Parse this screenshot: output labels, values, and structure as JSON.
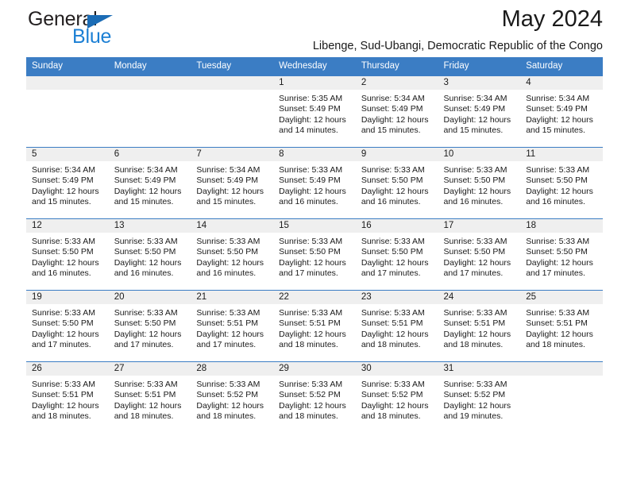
{
  "brand": {
    "name_top": "General",
    "name_bottom": "Blue",
    "triangle_color": "#1b6cb5",
    "blue_color": "#1b7fd4"
  },
  "header": {
    "title": "May 2024",
    "subtitle": "Libenge, Sud-Ubangi, Democratic Republic of the Congo"
  },
  "theme": {
    "header_bg": "#3b7dc4",
    "daynum_bg": "#efefef",
    "text": "#1a1a1a"
  },
  "calendar": {
    "weekday_headers": [
      "Sunday",
      "Monday",
      "Tuesday",
      "Wednesday",
      "Thursday",
      "Friday",
      "Saturday"
    ],
    "weeks": [
      [
        {
          "day": "",
          "lines": []
        },
        {
          "day": "",
          "lines": []
        },
        {
          "day": "",
          "lines": []
        },
        {
          "day": "1",
          "lines": [
            "Sunrise: 5:35 AM",
            "Sunset: 5:49 PM",
            "Daylight: 12 hours",
            "and 14 minutes."
          ]
        },
        {
          "day": "2",
          "lines": [
            "Sunrise: 5:34 AM",
            "Sunset: 5:49 PM",
            "Daylight: 12 hours",
            "and 15 minutes."
          ]
        },
        {
          "day": "3",
          "lines": [
            "Sunrise: 5:34 AM",
            "Sunset: 5:49 PM",
            "Daylight: 12 hours",
            "and 15 minutes."
          ]
        },
        {
          "day": "4",
          "lines": [
            "Sunrise: 5:34 AM",
            "Sunset: 5:49 PM",
            "Daylight: 12 hours",
            "and 15 minutes."
          ]
        }
      ],
      [
        {
          "day": "5",
          "lines": [
            "Sunrise: 5:34 AM",
            "Sunset: 5:49 PM",
            "Daylight: 12 hours",
            "and 15 minutes."
          ]
        },
        {
          "day": "6",
          "lines": [
            "Sunrise: 5:34 AM",
            "Sunset: 5:49 PM",
            "Daylight: 12 hours",
            "and 15 minutes."
          ]
        },
        {
          "day": "7",
          "lines": [
            "Sunrise: 5:34 AM",
            "Sunset: 5:49 PM",
            "Daylight: 12 hours",
            "and 15 minutes."
          ]
        },
        {
          "day": "8",
          "lines": [
            "Sunrise: 5:33 AM",
            "Sunset: 5:49 PM",
            "Daylight: 12 hours",
            "and 16 minutes."
          ]
        },
        {
          "day": "9",
          "lines": [
            "Sunrise: 5:33 AM",
            "Sunset: 5:50 PM",
            "Daylight: 12 hours",
            "and 16 minutes."
          ]
        },
        {
          "day": "10",
          "lines": [
            "Sunrise: 5:33 AM",
            "Sunset: 5:50 PM",
            "Daylight: 12 hours",
            "and 16 minutes."
          ]
        },
        {
          "day": "11",
          "lines": [
            "Sunrise: 5:33 AM",
            "Sunset: 5:50 PM",
            "Daylight: 12 hours",
            "and 16 minutes."
          ]
        }
      ],
      [
        {
          "day": "12",
          "lines": [
            "Sunrise: 5:33 AM",
            "Sunset: 5:50 PM",
            "Daylight: 12 hours",
            "and 16 minutes."
          ]
        },
        {
          "day": "13",
          "lines": [
            "Sunrise: 5:33 AM",
            "Sunset: 5:50 PM",
            "Daylight: 12 hours",
            "and 16 minutes."
          ]
        },
        {
          "day": "14",
          "lines": [
            "Sunrise: 5:33 AM",
            "Sunset: 5:50 PM",
            "Daylight: 12 hours",
            "and 16 minutes."
          ]
        },
        {
          "day": "15",
          "lines": [
            "Sunrise: 5:33 AM",
            "Sunset: 5:50 PM",
            "Daylight: 12 hours",
            "and 17 minutes."
          ]
        },
        {
          "day": "16",
          "lines": [
            "Sunrise: 5:33 AM",
            "Sunset: 5:50 PM",
            "Daylight: 12 hours",
            "and 17 minutes."
          ]
        },
        {
          "day": "17",
          "lines": [
            "Sunrise: 5:33 AM",
            "Sunset: 5:50 PM",
            "Daylight: 12 hours",
            "and 17 minutes."
          ]
        },
        {
          "day": "18",
          "lines": [
            "Sunrise: 5:33 AM",
            "Sunset: 5:50 PM",
            "Daylight: 12 hours",
            "and 17 minutes."
          ]
        }
      ],
      [
        {
          "day": "19",
          "lines": [
            "Sunrise: 5:33 AM",
            "Sunset: 5:50 PM",
            "Daylight: 12 hours",
            "and 17 minutes."
          ]
        },
        {
          "day": "20",
          "lines": [
            "Sunrise: 5:33 AM",
            "Sunset: 5:50 PM",
            "Daylight: 12 hours",
            "and 17 minutes."
          ]
        },
        {
          "day": "21",
          "lines": [
            "Sunrise: 5:33 AM",
            "Sunset: 5:51 PM",
            "Daylight: 12 hours",
            "and 17 minutes."
          ]
        },
        {
          "day": "22",
          "lines": [
            "Sunrise: 5:33 AM",
            "Sunset: 5:51 PM",
            "Daylight: 12 hours",
            "and 18 minutes."
          ]
        },
        {
          "day": "23",
          "lines": [
            "Sunrise: 5:33 AM",
            "Sunset: 5:51 PM",
            "Daylight: 12 hours",
            "and 18 minutes."
          ]
        },
        {
          "day": "24",
          "lines": [
            "Sunrise: 5:33 AM",
            "Sunset: 5:51 PM",
            "Daylight: 12 hours",
            "and 18 minutes."
          ]
        },
        {
          "day": "25",
          "lines": [
            "Sunrise: 5:33 AM",
            "Sunset: 5:51 PM",
            "Daylight: 12 hours",
            "and 18 minutes."
          ]
        }
      ],
      [
        {
          "day": "26",
          "lines": [
            "Sunrise: 5:33 AM",
            "Sunset: 5:51 PM",
            "Daylight: 12 hours",
            "and 18 minutes."
          ]
        },
        {
          "day": "27",
          "lines": [
            "Sunrise: 5:33 AM",
            "Sunset: 5:51 PM",
            "Daylight: 12 hours",
            "and 18 minutes."
          ]
        },
        {
          "day": "28",
          "lines": [
            "Sunrise: 5:33 AM",
            "Sunset: 5:52 PM",
            "Daylight: 12 hours",
            "and 18 minutes."
          ]
        },
        {
          "day": "29",
          "lines": [
            "Sunrise: 5:33 AM",
            "Sunset: 5:52 PM",
            "Daylight: 12 hours",
            "and 18 minutes."
          ]
        },
        {
          "day": "30",
          "lines": [
            "Sunrise: 5:33 AM",
            "Sunset: 5:52 PM",
            "Daylight: 12 hours",
            "and 18 minutes."
          ]
        },
        {
          "day": "31",
          "lines": [
            "Sunrise: 5:33 AM",
            "Sunset: 5:52 PM",
            "Daylight: 12 hours",
            "and 19 minutes."
          ]
        },
        {
          "day": "",
          "lines": []
        }
      ]
    ]
  }
}
